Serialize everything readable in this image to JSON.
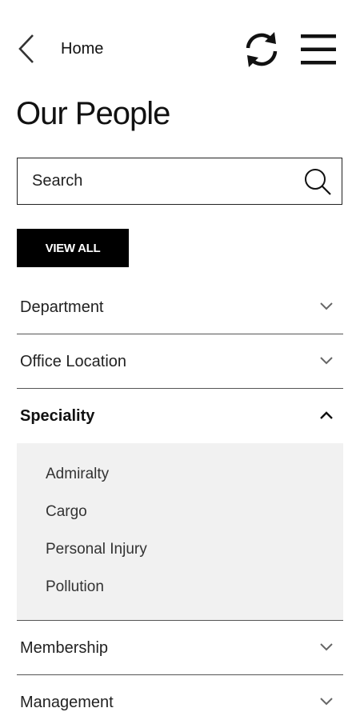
{
  "header": {
    "back_label": "Home"
  },
  "page": {
    "title": "Our People"
  },
  "search": {
    "placeholder": "Search",
    "value": ""
  },
  "actions": {
    "view_all_label": "VIEW ALL"
  },
  "filters": [
    {
      "label": "Department",
      "expanded": false
    },
    {
      "label": "Office Location",
      "expanded": false
    },
    {
      "label": "Speciality",
      "expanded": true,
      "options": [
        "Admiralty",
        "Cargo",
        "Personal Injury",
        "Pollution"
      ]
    },
    {
      "label": "Membership",
      "expanded": false
    },
    {
      "label": "Management",
      "expanded": false
    }
  ],
  "icons": {
    "back": "chevron-left-icon",
    "refresh": "refresh-icon",
    "menu": "hamburger-menu-icon",
    "search": "search-icon",
    "expand": "chevron-down-icon",
    "collapse": "chevron-up-icon"
  },
  "colors": {
    "accent_button": "#000000",
    "panel_bg": "#f1f1f1",
    "divider": "#555555"
  }
}
